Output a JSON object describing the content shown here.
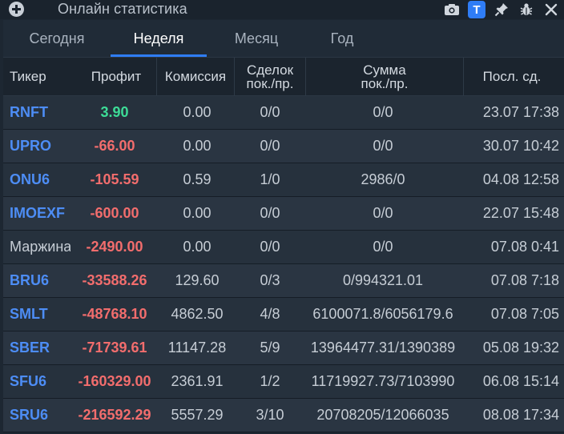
{
  "window": {
    "title": "Онлайн статистика"
  },
  "toolbar": {
    "t_badge": "T"
  },
  "tabs": [
    {
      "label": "Сегодня",
      "active": false
    },
    {
      "label": "Неделя",
      "active": true
    },
    {
      "label": "Месяц",
      "active": false
    },
    {
      "label": "Год",
      "active": false
    }
  ],
  "columns": {
    "ticker": "Тикер",
    "profit": "Профит",
    "commission": "Комиссия",
    "deals_line1": "Сделок",
    "deals_line2": "пок./пр.",
    "sum_line1": "Сумма",
    "sum_line2": "пок./пр.",
    "last": "Посл. сд."
  },
  "rows": [
    {
      "ticker": "RNFT",
      "profit": "3.90",
      "commission": "0.00",
      "deals": "0/0",
      "sum": "0/0",
      "last": "23.07 17:38"
    },
    {
      "ticker": "UPRO",
      "profit": "-66.00",
      "commission": "0.00",
      "deals": "0/0",
      "sum": "0/0",
      "last": "30.07 10:42"
    },
    {
      "ticker": "ONU6",
      "profit": "-105.59",
      "commission": "0.59",
      "deals": "1/0",
      "sum": "2986/0",
      "last": "04.08 12:58"
    },
    {
      "ticker": "IMOEXF",
      "profit": "-600.00",
      "commission": "0.00",
      "deals": "0/0",
      "sum": "0/0",
      "last": "22.07 15:48"
    },
    {
      "ticker": "Маржина",
      "profit": "-2490.00",
      "commission": "0.00",
      "deals": "0/0",
      "sum": "0/0",
      "last": "07.08 0:41"
    },
    {
      "ticker": "BRU6",
      "profit": "-33588.26",
      "commission": "129.60",
      "deals": "0/3",
      "sum": "0/994321.01",
      "last": "07.08 7:18"
    },
    {
      "ticker": "SMLT",
      "profit": "-48768.10",
      "commission": "4862.50",
      "deals": "4/8",
      "sum": "6100071.8/6056179.6",
      "last": "07.08 7:05"
    },
    {
      "ticker": "SBER",
      "profit": "-71739.61",
      "commission": "11147.28",
      "deals": "5/9",
      "sum": "13964477.31/1390389",
      "last": "05.08 19:32"
    },
    {
      "ticker": "SFU6",
      "profit": "-160329.00",
      "commission": "2361.91",
      "deals": "1/2",
      "sum": "11719927.73/7103990",
      "last": "06.08 15:14"
    },
    {
      "ticker": "SRU6",
      "profit": "-216592.29",
      "commission": "5557.29",
      "deals": "3/10",
      "sum": "20708205/12066035",
      "last": "08.08 17:34"
    }
  ],
  "colors": {
    "ticker": "#4d8df5",
    "profit_negative": "#f26d6d",
    "profit_positive": "#3ddc97",
    "accent": "#2f7df6"
  }
}
